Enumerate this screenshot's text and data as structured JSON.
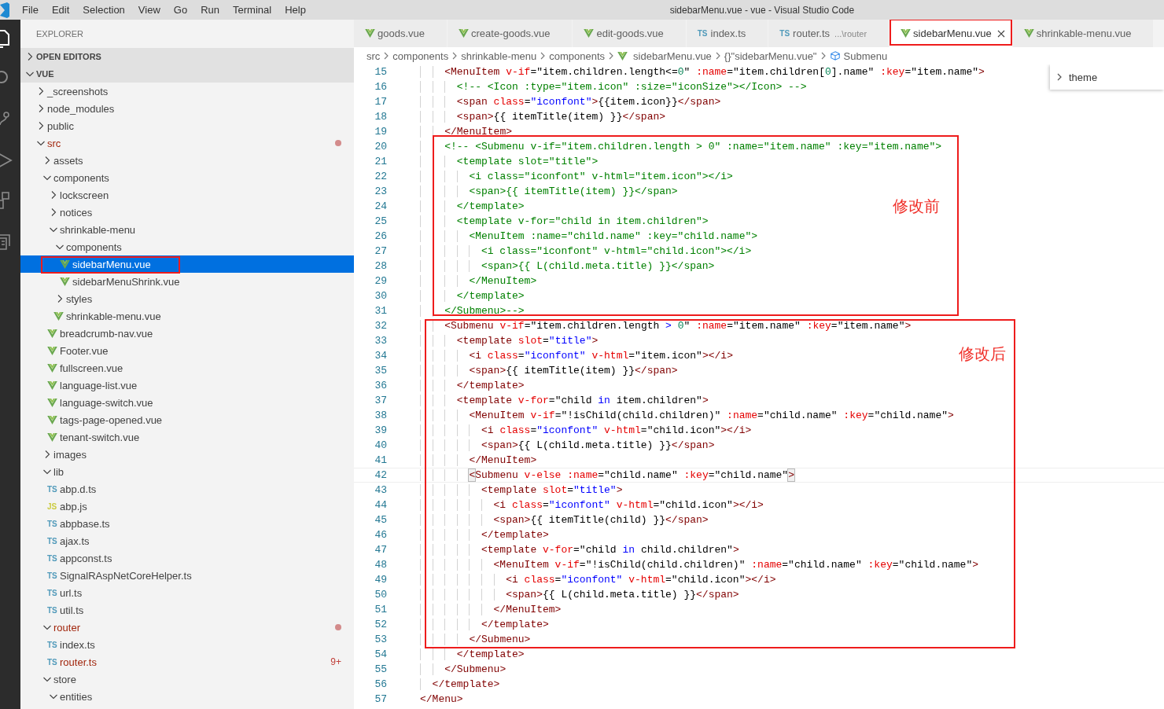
{
  "window": {
    "title": "sidebarMenu.vue - vue - Visual Studio Code"
  },
  "menu": [
    "File",
    "Edit",
    "Selection",
    "View",
    "Go",
    "Run",
    "Terminal",
    "Help"
  ],
  "activity_bar": [
    {
      "kind": "files",
      "selected": true
    },
    {
      "kind": "search",
      "selected": false
    },
    {
      "kind": "branch",
      "selected": false
    },
    {
      "kind": "run",
      "selected": false
    },
    {
      "kind": "extensions",
      "selected": false
    },
    {
      "kind": "copies",
      "selected": false
    }
  ],
  "sidebar": {
    "title": "EXPLORER",
    "sections": [
      {
        "title": "OPEN EDITORS",
        "expanded": false
      },
      {
        "title": "VUE",
        "expanded": true,
        "tree": [
          {
            "name": "_screenshots",
            "kind": "folder",
            "expanded": false,
            "selected": false
          },
          {
            "name": "node_modules",
            "kind": "folder",
            "expanded": false,
            "selected": false
          },
          {
            "name": "public",
            "kind": "folder",
            "expanded": false,
            "selected": false
          },
          {
            "name": "src",
            "kind": "folder",
            "expanded": true,
            "selected": false,
            "modified": true,
            "children": [
              {
                "name": "assets",
                "kind": "folder",
                "expanded": false,
                "selected": false
              },
              {
                "name": "components",
                "kind": "folder",
                "expanded": true,
                "selected": false,
                "children": [
                  {
                    "name": "lockscreen",
                    "kind": "folder",
                    "expanded": false,
                    "selected": false
                  },
                  {
                    "name": "notices",
                    "kind": "folder",
                    "expanded": false,
                    "selected": false
                  },
                  {
                    "name": "shrinkable-menu",
                    "kind": "folder",
                    "expanded": true,
                    "selected": false,
                    "children": [
                      {
                        "name": "components",
                        "kind": "folder",
                        "expanded": true,
                        "selected": false,
                        "children": [
                          {
                            "name": "sidebarMenu.vue",
                            "kind": "vue",
                            "selected": true,
                            "outlined": true
                          },
                          {
                            "name": "sidebarMenuShrink.vue",
                            "kind": "vue",
                            "selected": false
                          }
                        ]
                      },
                      {
                        "name": "styles",
                        "kind": "folder",
                        "expanded": false,
                        "selected": false
                      },
                      {
                        "name": "shrinkable-menu.vue",
                        "kind": "vue",
                        "selected": false
                      }
                    ]
                  },
                  {
                    "name": "breadcrumb-nav.vue",
                    "kind": "vue",
                    "selected": false
                  },
                  {
                    "name": "Footer.vue",
                    "kind": "vue",
                    "selected": false
                  },
                  {
                    "name": "fullscreen.vue",
                    "kind": "vue",
                    "selected": false
                  },
                  {
                    "name": "language-list.vue",
                    "kind": "vue",
                    "selected": false
                  },
                  {
                    "name": "language-switch.vue",
                    "kind": "vue",
                    "selected": false
                  },
                  {
                    "name": "tags-page-opened.vue",
                    "kind": "vue",
                    "selected": false
                  },
                  {
                    "name": "tenant-switch.vue",
                    "kind": "vue",
                    "selected": false
                  }
                ]
              },
              {
                "name": "images",
                "kind": "folder",
                "expanded": false,
                "selected": false
              },
              {
                "name": "lib",
                "kind": "folder",
                "expanded": true,
                "selected": false,
                "children": [
                  {
                    "name": "abp.d.ts",
                    "kind": "ts",
                    "icon_text": "TS",
                    "selected": false
                  },
                  {
                    "name": "abp.js",
                    "kind": "js",
                    "icon_text": "JS",
                    "selected": false
                  },
                  {
                    "name": "abpbase.ts",
                    "kind": "ts",
                    "icon_text": "TS",
                    "selected": false
                  },
                  {
                    "name": "ajax.ts",
                    "kind": "ts",
                    "icon_text": "TS",
                    "selected": false
                  },
                  {
                    "name": "appconst.ts",
                    "kind": "ts",
                    "icon_text": "TS",
                    "selected": false
                  },
                  {
                    "name": "SignalRAspNetCoreHelper.ts",
                    "kind": "ts",
                    "icon_text": "TS",
                    "selected": false
                  },
                  {
                    "name": "url.ts",
                    "kind": "ts",
                    "icon_text": "TS",
                    "selected": false
                  },
                  {
                    "name": "util.ts",
                    "kind": "ts",
                    "icon_text": "TS",
                    "selected": false
                  }
                ]
              },
              {
                "name": "router",
                "kind": "folder",
                "expanded": true,
                "selected": false,
                "modified": true,
                "children": [
                  {
                    "name": "index.ts",
                    "kind": "ts",
                    "icon_text": "TS",
                    "selected": false
                  },
                  {
                    "name": "router.ts",
                    "kind": "ts",
                    "icon_text": "TS",
                    "selected": false,
                    "problems": "9+"
                  }
                ]
              },
              {
                "name": "store",
                "kind": "folder",
                "expanded": true,
                "selected": false,
                "children": [
                  {
                    "name": "entities",
                    "kind": "folder",
                    "expanded": true,
                    "selected": false
                  }
                ]
              }
            ]
          }
        ]
      }
    ]
  },
  "tabs": [
    {
      "label": "goods.vue",
      "kind": "vue",
      "selected": false
    },
    {
      "label": "create-goods.vue",
      "kind": "vue",
      "selected": false
    },
    {
      "label": "edit-goods.vue",
      "kind": "vue",
      "selected": false
    },
    {
      "label": "index.ts",
      "kind": "ts",
      "icon_text": "TS",
      "selected": false
    },
    {
      "label": "router.ts",
      "kind": "ts",
      "icon_text": "TS",
      "description": "...\\router",
      "selected": false
    },
    {
      "label": "sidebarMenu.vue",
      "kind": "vue",
      "selected": true,
      "outlined": true
    },
    {
      "label": "shrinkable-menu.vue",
      "kind": "vue",
      "selected": false
    }
  ],
  "breadcrumbs": [
    {
      "label": "src"
    },
    {
      "label": "components"
    },
    {
      "label": "shrinkable-menu"
    },
    {
      "label": "components"
    },
    {
      "label": "sidebarMenu.vue",
      "kind": "file"
    },
    {
      "label": "\"sidebarMenu.vue\"",
      "prefix": "{}"
    },
    {
      "label": "Submenu",
      "kind": "symbol"
    }
  ],
  "peek": {
    "label": "theme"
  },
  "editor": {
    "blocks": [
      {
        "kind": "plain",
        "lines": [
          {
            "number": "15",
            "text": "    <MenuItem v-if=\"item.children.length<=0\" :name=\"item.children[0].name\" :key=\"item.name\">"
          },
          {
            "number": "16",
            "text": "      <!-- <Icon :type=\"item.icon\" :size=\"iconSize\"></Icon> -->"
          },
          {
            "number": "17",
            "text": "      <span class=\"iconfont\">{{item.icon}}</span>"
          },
          {
            "number": "18",
            "text": "      <span>{{ itemTitle(item) }}</span>"
          },
          {
            "number": "19",
            "text": "    </MenuItem>"
          }
        ]
      },
      {
        "kind": "annotated",
        "note": "修改前",
        "lines": [
          {
            "number": "20",
            "text": "    <!-- <Submenu v-if=\"item.children.length > 0\" :name=\"item.name\" :key=\"item.name\">"
          },
          {
            "number": "21",
            "text": "      <template slot=\"title\">"
          },
          {
            "number": "22",
            "text": "        <i class=\"iconfont\" v-html=\"item.icon\"></i>"
          },
          {
            "number": "23",
            "text": "        <span>{{ itemTitle(item) }}</span>"
          },
          {
            "number": "24",
            "text": "      </template>"
          },
          {
            "number": "25",
            "text": "      <template v-for=\"child in item.children\">"
          },
          {
            "number": "26",
            "text": "        <MenuItem :name=\"child.name\" :key=\"child.name\">"
          },
          {
            "number": "27",
            "text": "          <i class=\"iconfont\" v-html=\"child.icon\"></i>"
          },
          {
            "number": "28",
            "text": "          <span>{{ L(child.meta.title) }}</span>"
          },
          {
            "number": "29",
            "text": "        </MenuItem>"
          },
          {
            "number": "30",
            "text": "      </template>"
          },
          {
            "number": "31",
            "text": "    </Submenu>-->"
          }
        ]
      },
      {
        "kind": "annotated",
        "note": "修改后",
        "lines": [
          {
            "number": "32",
            "text": "    <Submenu v-if=\"item.children.length > 0\" :name=\"item.name\" :key=\"item.name\">"
          },
          {
            "number": "33",
            "text": "      <template slot=\"title\">"
          },
          {
            "number": "34",
            "text": "        <i class=\"iconfont\" v-html=\"item.icon\"></i>"
          },
          {
            "number": "35",
            "text": "        <span>{{ itemTitle(item) }}</span>"
          },
          {
            "number": "36",
            "text": "      </template>"
          },
          {
            "number": "37",
            "text": "      <template v-for=\"child in item.children\">"
          },
          {
            "number": "38",
            "text": "        <MenuItem v-if=\"!isChild(child.children)\" :name=\"child.name\" :key=\"child.name\">"
          },
          {
            "number": "39",
            "text": "          <i class=\"iconfont\" v-html=\"child.icon\"></i>"
          },
          {
            "number": "40",
            "text": "          <span>{{ L(child.meta.title) }}</span>"
          },
          {
            "number": "41",
            "text": "        </MenuItem>"
          },
          {
            "number": "42",
            "text": "        <Submenu v-else :name=\"child.name\" :key=\"child.name\">",
            "current": true
          },
          {
            "number": "43",
            "text": "          <template slot=\"title\">"
          },
          {
            "number": "44",
            "text": "            <i class=\"iconfont\" v-html=\"child.icon\"></i>"
          },
          {
            "number": "45",
            "text": "            <span>{{ itemTitle(child) }}</span>"
          },
          {
            "number": "46",
            "text": "          </template>"
          },
          {
            "number": "47",
            "text": "          <template v-for=\"child in child.children\">"
          },
          {
            "number": "48",
            "text": "            <MenuItem v-if=\"!isChild(child.children)\" :name=\"child.name\" :key=\"child.name\">"
          },
          {
            "number": "49",
            "text": "              <i class=\"iconfont\" v-html=\"child.icon\"></i>"
          },
          {
            "number": "50",
            "text": "              <span>{{ L(child.meta.title) }}</span>"
          },
          {
            "number": "51",
            "text": "            </MenuItem>"
          },
          {
            "number": "52",
            "text": "          </template>"
          },
          {
            "number": "53",
            "text": "        </Submenu>"
          }
        ]
      },
      {
        "kind": "plain",
        "lines": [
          {
            "number": "54",
            "text": "      </template>"
          },
          {
            "number": "55",
            "text": "    </Submenu>"
          },
          {
            "number": "56",
            "text": "  </template>"
          },
          {
            "number": "57",
            "text": "</Menu>"
          }
        ]
      }
    ]
  }
}
